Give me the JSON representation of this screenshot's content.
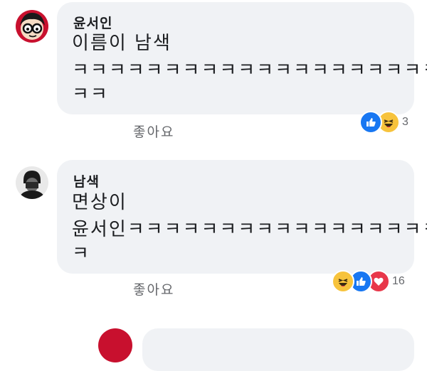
{
  "comments": [
    {
      "author": "윤서인",
      "lines": [
        "이름이 남색",
        "ㅋㅋㅋㅋㅋㅋㅋㅋㅋㅋㅋㅋㅋㅋㅋㅋㅋㅋㅋㅋ",
        "ㅋㅋ"
      ],
      "like_label": "좋아요",
      "reaction_count": "3",
      "reactions": [
        "like-icon",
        "haha-icon"
      ]
    },
    {
      "author": "남색",
      "lines": [
        "면상이",
        "윤서인ㅋㅋㅋㅋㅋㅋㅋㅋㅋㅋㅋㅋㅋㅋㅋㅋㅋ",
        "ㅋ"
      ],
      "like_label": "좋아요",
      "reaction_count": "16",
      "reactions": [
        "haha-icon",
        "like-icon",
        "love-icon"
      ]
    }
  ],
  "colors": {
    "bubble": "#f0f2f5",
    "like_blue": "#1877f2",
    "haha_yellow": "#f7c33c",
    "love_red": "#e8374a"
  }
}
